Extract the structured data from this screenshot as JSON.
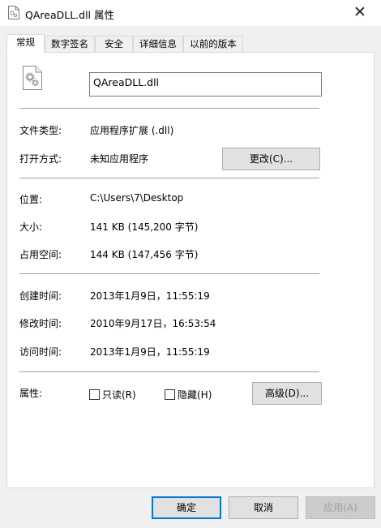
{
  "window": {
    "title": "QAreaDLL.dll 属性",
    "close_glyph": "✕",
    "icon": "dll-file-icon"
  },
  "tabs": [
    {
      "label": "常规",
      "active": true
    },
    {
      "label": "数字签名",
      "active": false
    },
    {
      "label": "安全",
      "active": false
    },
    {
      "label": "详细信息",
      "active": false
    },
    {
      "label": "以前的版本",
      "active": false
    }
  ],
  "general": {
    "file_name": "QAreaDLL.dll",
    "file_type_label": "文件类型:",
    "file_type_value": "应用程序扩展 (.dll)",
    "opens_with_label": "打开方式:",
    "opens_with_value": "未知应用程序",
    "change_button": "更改(C)...",
    "location_label": "位置:",
    "location_value": "C:\\Users\\7\\Desktop",
    "size_label": "大小:",
    "size_value": "141 KB (145,200 字节)",
    "size_on_disk_label": "占用空间:",
    "size_on_disk_value": "144 KB (147,456 字节)",
    "created_label": "创建时间:",
    "created_value": "2013年1月9日，11:55:19",
    "modified_label": "修改时间:",
    "modified_value": "2010年9月17日，16:53:54",
    "accessed_label": "访问时间:",
    "accessed_value": "2013年1月9日，11:55:19",
    "attributes_label": "属性:",
    "readonly_label": "只读(R)",
    "readonly_checked": false,
    "hidden_label": "隐藏(H)",
    "hidden_checked": false,
    "advanced_button": "高级(D)..."
  },
  "footer": {
    "ok_button": "确定",
    "cancel_button": "取消",
    "apply_button": "应用(A)"
  },
  "colors": {
    "accent": "#0078d7",
    "panel_bg": "#ffffff",
    "window_bg": "#f0f0f0",
    "button_bg": "#e1e1e1"
  }
}
